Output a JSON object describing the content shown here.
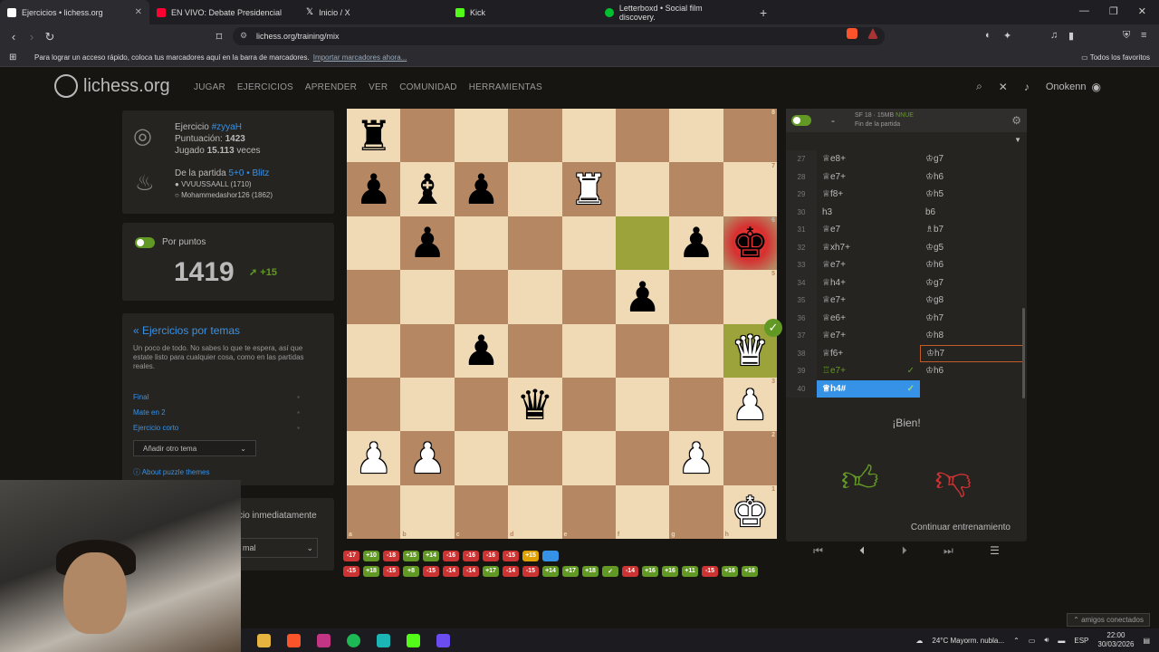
{
  "browser": {
    "tabs": [
      {
        "title": "Ejercicios • lichess.org",
        "color": "#ffffff"
      },
      {
        "title": "EN VIVO: Debate Presidencial",
        "color": "#ff0033"
      },
      {
        "title": "Inicio / X",
        "color": "#ffffff"
      },
      {
        "title": "Kick",
        "color": "#53fc18"
      },
      {
        "title": "Letterboxd • Social film discovery.",
        "color": "#00c030"
      }
    ],
    "url": "lichess.org/training/mix",
    "bookmarks_text": "Para lograr un acceso rápido, coloca tus marcadores aquí en la barra de marcadores.",
    "bookmarks_link": "Importar marcadores ahora...",
    "all_favorites": "Todos los favoritos"
  },
  "site": {
    "logo": "lichess.org",
    "nav": [
      "JUGAR",
      "EJERCICIOS",
      "APRENDER",
      "VER",
      "COMUNIDAD",
      "HERRAMIENTAS"
    ],
    "username": "Onokenn"
  },
  "puzzle": {
    "label": "Ejercicio",
    "id": "#zyyaH",
    "rating_label": "Puntuación:",
    "rating": "1423",
    "played_label": "Jugado",
    "played": "15.113",
    "played_suffix": "veces",
    "game_label": "De la partida",
    "game_type": "5+0 • Blitz",
    "players": [
      "VVUUSSAALL (1710)",
      "Mohammedashor126 (1862)"
    ]
  },
  "score": {
    "toggle_label": "Por puntos",
    "value": "1419",
    "delta": "+15"
  },
  "themes": {
    "back_link": "« Ejercicios por temas",
    "description": "Un poco de todo. No sabes lo que te espera, así que estate listo para cualquier cosa, como en las partidas reales.",
    "items": [
      "Final",
      "Mate en 2",
      "Ejercicio corto"
    ],
    "add_theme": "Añadir otro tema",
    "about": "About puzzle themes"
  },
  "next_panel": {
    "text": "cio inmediatamente",
    "select": "mal"
  },
  "board": {
    "rows": [
      [
        [
          "r",
          "b"
        ],
        "",
        "",
        "",
        "",
        "",
        "",
        ""
      ],
      [
        [
          "p",
          "b"
        ],
        [
          "b",
          "b"
        ],
        [
          "p",
          "b"
        ],
        "",
        [
          "r",
          "w"
        ],
        "",
        "",
        ""
      ],
      [
        "",
        [
          "p",
          "b"
        ],
        "",
        "",
        "",
        "",
        [
          "p",
          "b"
        ],
        [
          "k",
          "b"
        ]
      ],
      [
        "",
        "",
        "",
        "",
        "",
        [
          "p",
          "b"
        ],
        "",
        ""
      ],
      [
        "",
        "",
        [
          "p",
          "b"
        ],
        "",
        "",
        "",
        "",
        [
          "q",
          "w"
        ]
      ],
      [
        "",
        "",
        "",
        [
          "q",
          "b"
        ],
        "",
        "",
        "",
        [
          "p",
          "w"
        ]
      ],
      [
        [
          "p",
          "w"
        ],
        [
          "p",
          "w"
        ],
        "",
        "",
        "",
        "",
        [
          "p",
          "w"
        ],
        ""
      ],
      [
        "",
        "",
        "",
        "",
        "",
        "",
        "",
        [
          "k",
          "w"
        ]
      ]
    ],
    "highlight": [
      [
        2,
        5
      ],
      [
        4,
        7
      ]
    ],
    "check": [
      2,
      7
    ],
    "files": [
      "a",
      "b",
      "c",
      "d",
      "e",
      "f",
      "g",
      "h"
    ],
    "ranks": [
      "8",
      "7",
      "6",
      "5",
      "4",
      "3",
      "2",
      "1"
    ]
  },
  "history": {
    "row1": [
      [
        "-17",
        "bad"
      ],
      [
        "+10",
        "good"
      ],
      [
        "-18",
        "bad"
      ],
      [
        "+15",
        "good"
      ],
      [
        "+14",
        "good"
      ],
      [
        "-16",
        "bad"
      ],
      [
        "-16",
        "bad"
      ],
      [
        "-16",
        "bad"
      ],
      [
        "-15",
        "bad"
      ],
      [
        "+15",
        "cur"
      ],
      [
        "",
        "blue"
      ]
    ],
    "row2": [
      [
        "-15",
        "bad"
      ],
      [
        "+18",
        "good"
      ],
      [
        "-15",
        "bad"
      ],
      [
        "+8",
        "good"
      ],
      [
        "-15",
        "bad"
      ],
      [
        "-14",
        "bad"
      ],
      [
        "-14",
        "bad"
      ],
      [
        "+17",
        "good"
      ],
      [
        "-14",
        "bad"
      ],
      [
        "-15",
        "bad"
      ],
      [
        "+14",
        "good"
      ],
      [
        "+17",
        "good"
      ],
      [
        "+18",
        "good"
      ],
      [
        "✓",
        "good"
      ],
      [
        "-14",
        "bad"
      ],
      [
        "+16",
        "good"
      ],
      [
        "+16",
        "good"
      ],
      [
        "+11",
        "good"
      ],
      [
        "-15",
        "bad"
      ],
      [
        "+16",
        "good"
      ],
      [
        "+16",
        "good"
      ]
    ]
  },
  "engine": {
    "name": "SF 18 · 15MB",
    "tag": "NNUE",
    "status": "Fin de la partida"
  },
  "moves": [
    {
      "n": "27",
      "w": "♕e8+",
      "b": "♔g7"
    },
    {
      "n": "28",
      "w": "♕e7+",
      "b": "♔h6"
    },
    {
      "n": "29",
      "w": "♕f8+",
      "b": "♔h5"
    },
    {
      "n": "30",
      "w": "h3",
      "b": "b6"
    },
    {
      "n": "31",
      "w": "♕e7",
      "b": "♗b7"
    },
    {
      "n": "32",
      "w": "♕xh7+",
      "b": "♔g5"
    },
    {
      "n": "33",
      "w": "♕e7+",
      "b": "♔h6"
    },
    {
      "n": "34",
      "w": "♕h4+",
      "b": "♔g7"
    },
    {
      "n": "35",
      "w": "♕e7+",
      "b": "♔g8"
    },
    {
      "n": "36",
      "w": "♕e6+",
      "b": "♔h7"
    },
    {
      "n": "37",
      "w": "♕e7+",
      "b": "♔h8"
    },
    {
      "n": "38",
      "w": "♕f6+",
      "b": "♔h7"
    },
    {
      "n": "39",
      "w": "♖e7+",
      "b": "♔h6"
    },
    {
      "n": "40",
      "w": "♕h4#",
      "b": ""
    }
  ],
  "feedback": "¡Bien!",
  "continue": "Continuar entrenamiento",
  "system": {
    "weather": "24°C  Mayorm. nubla...",
    "lang": "ESP",
    "time": "22:00",
    "date": "30/03/2026",
    "friends": "amigos conectados"
  }
}
